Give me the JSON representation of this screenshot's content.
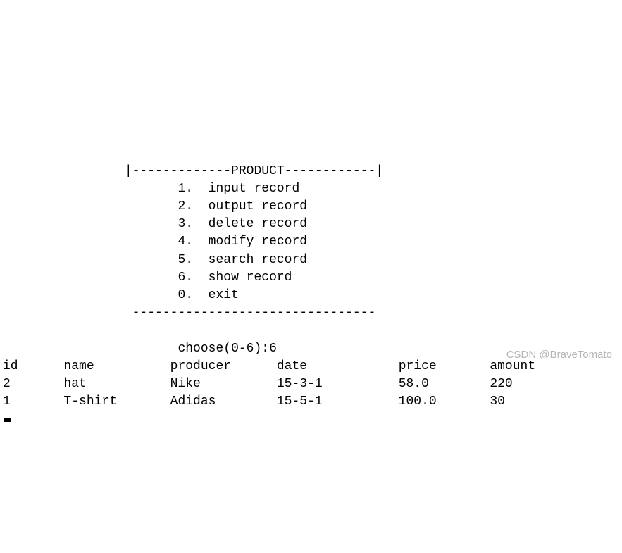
{
  "spacer_top": "\n\n\n\n",
  "menu": {
    "indent": "                ",
    "top_border": "|-------------PRODUCT------------|",
    "item_indent": "                       ",
    "items": [
      "1.  input record",
      "2.  output record",
      "3.  delete record",
      "4.  modify record",
      "5.  search record",
      "6.  show record",
      "0.  exit"
    ],
    "bottom_border": " --------------------------------"
  },
  "prompt": {
    "indent": "                       ",
    "label": "choose(0-6):",
    "value": "6"
  },
  "table": {
    "header": "id      name          producer      date            price       amount",
    "rows": [
      "2       hat           Nike          15-3-1          58.0        220",
      "1       T-shirt       Adidas        15-5-1          100.0       30"
    ]
  },
  "watermark": "CSDN @BraveTomato"
}
